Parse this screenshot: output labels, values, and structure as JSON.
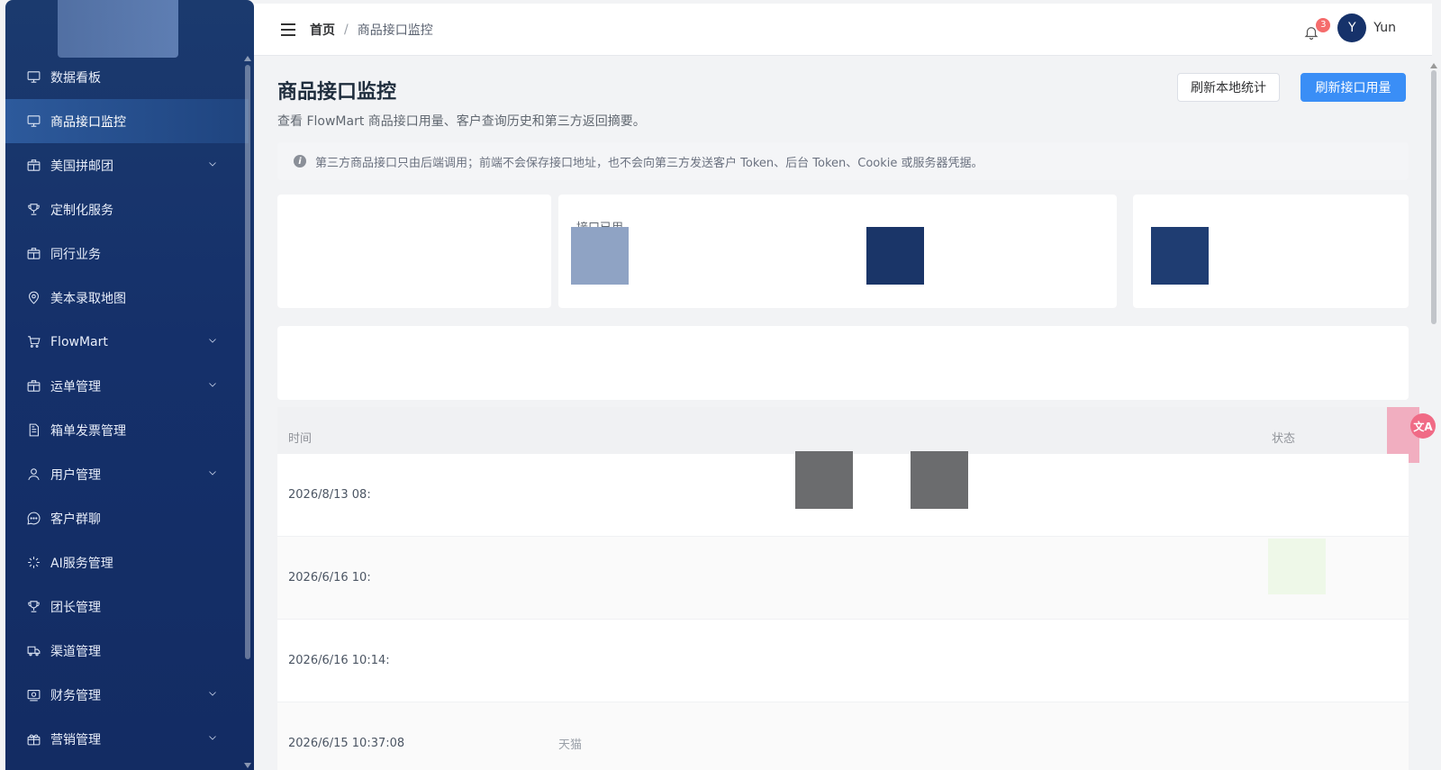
{
  "sidebar": {
    "items": [
      {
        "label": "数据看板",
        "icon": "monitor-icon",
        "has_children": false,
        "active": false
      },
      {
        "label": "商品接口监控",
        "icon": "monitor-icon",
        "has_children": false,
        "active": true
      },
      {
        "label": "美国拼邮团",
        "icon": "package-icon",
        "has_children": true,
        "active": false
      },
      {
        "label": "定制化服务",
        "icon": "trophy-icon",
        "has_children": false,
        "active": false
      },
      {
        "label": "同行业务",
        "icon": "package-icon",
        "has_children": false,
        "active": false
      },
      {
        "label": "美本录取地图",
        "icon": "map-pin-icon",
        "has_children": false,
        "active": false
      },
      {
        "label": "FlowMart",
        "icon": "cart-icon",
        "has_children": true,
        "active": false
      },
      {
        "label": "运单管理",
        "icon": "package-icon",
        "has_children": true,
        "active": false
      },
      {
        "label": "箱单发票管理",
        "icon": "document-icon",
        "has_children": false,
        "active": false
      },
      {
        "label": "用户管理",
        "icon": "user-icon",
        "has_children": true,
        "active": false
      },
      {
        "label": "客户群聊",
        "icon": "chat-icon",
        "has_children": false,
        "active": false
      },
      {
        "label": "AI服务管理",
        "icon": "loader-icon",
        "has_children": false,
        "active": false
      },
      {
        "label": "团长管理",
        "icon": "trophy-icon",
        "has_children": false,
        "active": false
      },
      {
        "label": "渠道管理",
        "icon": "truck-icon",
        "has_children": false,
        "active": false
      },
      {
        "label": "财务管理",
        "icon": "finance-icon",
        "has_children": true,
        "active": false
      },
      {
        "label": "营销管理",
        "icon": "gift-icon",
        "has_children": true,
        "active": false
      }
    ]
  },
  "header": {
    "breadcrumb_home": "首页",
    "breadcrumb_sep": "/",
    "breadcrumb_current": "商品接口监控",
    "notification_count": "3",
    "avatar_letter": "Y",
    "username": "Yun"
  },
  "main": {
    "title": "商品接口监控",
    "subtitle": "查看 FlowMart 商品接口用量、客户查询历史和第三方返回摘要。",
    "refresh_local_label": "刷新本地统计",
    "refresh_api_label": "刷新接口用量",
    "notice": "第三方商品接口只由后端调用；前端不会保存接口地址，也不会向第三方发送客户 Token、后台 Token、Cookie 或服务器凭据。",
    "stat_label": "接口已用",
    "table": {
      "header_time": "时间",
      "header_status": "状态",
      "rows": [
        {
          "time": "2026/8/13 08:",
          "source": ""
        },
        {
          "time": "2026/6/16 10:",
          "source": ""
        },
        {
          "time": "2026/6/16 10:14:",
          "source": ""
        },
        {
          "time": "2026/6/15 10:37:08",
          "source": "天猫"
        }
      ]
    }
  },
  "colors": {
    "sidebar_bg": "#15306a",
    "sidebar_active": "#2d5a9c",
    "primary_button": "#3a8ef6",
    "badge": "#f56c6c"
  }
}
